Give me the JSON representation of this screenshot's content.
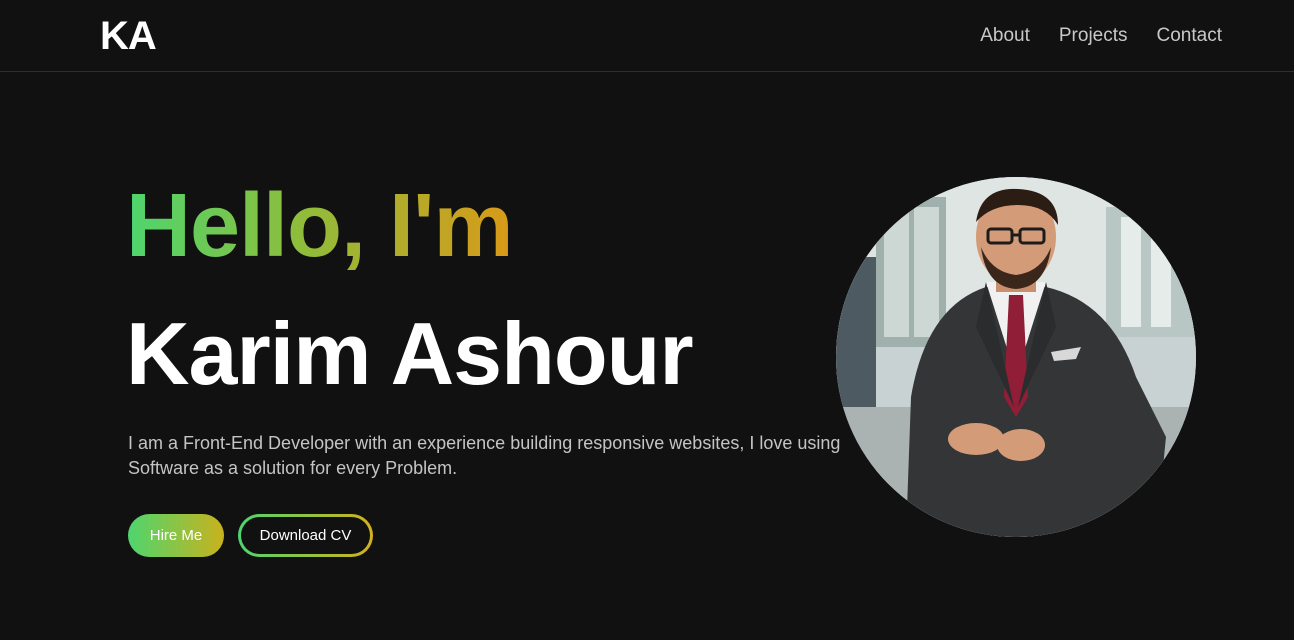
{
  "header": {
    "logo": "KA",
    "nav": [
      {
        "label": "About"
      },
      {
        "label": "Projects"
      },
      {
        "label": "Contact"
      }
    ]
  },
  "hero": {
    "greeting": "Hello, I'm",
    "name": "Karim Ashour",
    "bio": "I am a Front-End Developer with an experience building responsive websites, I love using Software as a solution for every Problem.",
    "hire_label": "Hire Me",
    "cv_label": "Download CV"
  },
  "colors": {
    "background": "#111111",
    "gradient_start": "#4ed56e",
    "gradient_end": "#d99a18",
    "text_muted": "#c4c4c4"
  },
  "icons": {
    "profile_photo": "profile-photo"
  }
}
